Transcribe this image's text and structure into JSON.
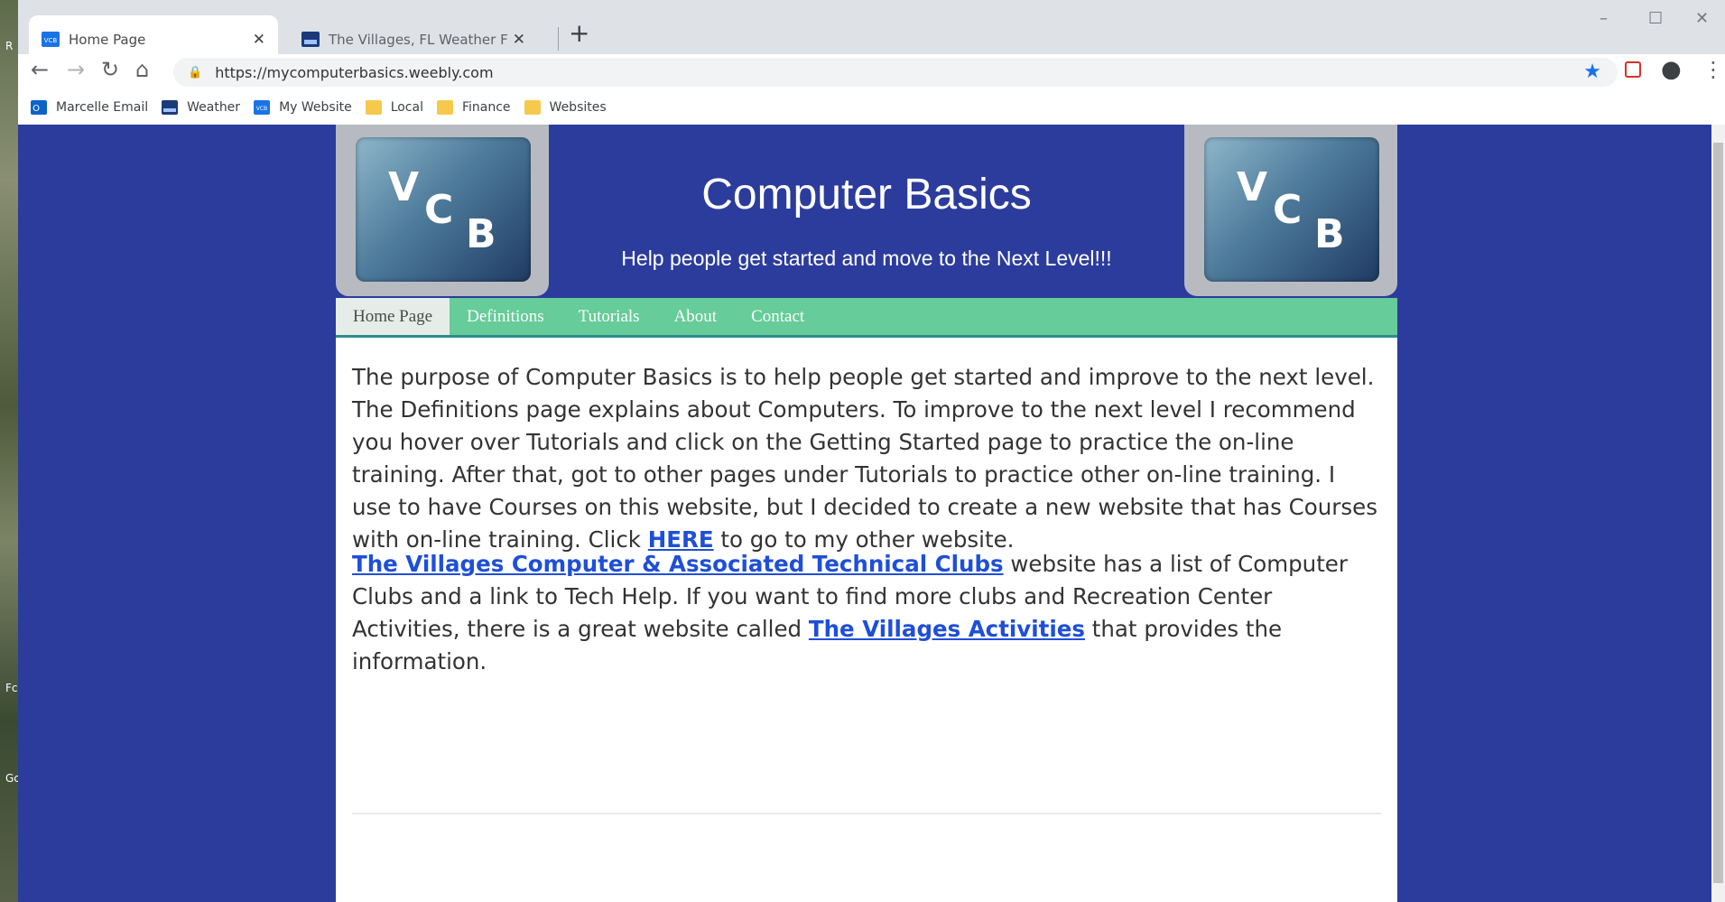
{
  "browser": {
    "tabs": [
      {
        "title": "Home Page",
        "active": true
      },
      {
        "title": "The Villages, FL Weather Forecast",
        "active": false
      }
    ],
    "url": "https://mycomputerbasics.weebly.com",
    "bookmarks": [
      {
        "label": "Marcelle Email",
        "icon": "outlook-icon"
      },
      {
        "label": "Weather",
        "icon": "weather-icon"
      },
      {
        "label": "My Website",
        "icon": "vcb-icon"
      },
      {
        "label": "Local",
        "icon": "folder-icon"
      },
      {
        "label": "Finance",
        "icon": "folder-icon"
      },
      {
        "label": "Websites",
        "icon": "folder-icon"
      }
    ]
  },
  "desktop": {
    "edge_labels": [
      "R",
      "Fc",
      "Gc"
    ]
  },
  "site": {
    "logo_letters": [
      "V",
      "C",
      "B"
    ],
    "title": "Computer Basics",
    "tagline": "Help people get started and move to the Next Level!!!",
    "nav": [
      "Home Page",
      "Definitions",
      "Tutorials",
      "About",
      "Contact"
    ],
    "nav_current": "Home Page",
    "para1": {
      "text": "The purpose of Computer Basics is to help people get started and improve to the next level. The Definitions page explains about Computers.  To improve to the next level I recommend you hover over Tutorials and click on the Getting Started page to practice the on-line training.  After that, got to other pages under Tutorials to practice other on-line training.  I use to have Courses on this website, but I decided to create a new website that has Courses with on-line training.  Click ",
      "link": "HERE",
      "after": " to go to my other website."
    },
    "para2": {
      "link1": "The Villages Computer & Associated Technical Clubs",
      "text1": " website has a list of Computer Clubs and a link to Tech Help.  If you want to find more clubs and Recreation Center Activities, there is a great website called ",
      "link2": "The Villages Activities",
      "text2": " that provides the information."
    }
  },
  "colors": {
    "page_bg": "#2c3c9c",
    "nav_bg": "#66cc99",
    "link": "#1f4fd8"
  }
}
